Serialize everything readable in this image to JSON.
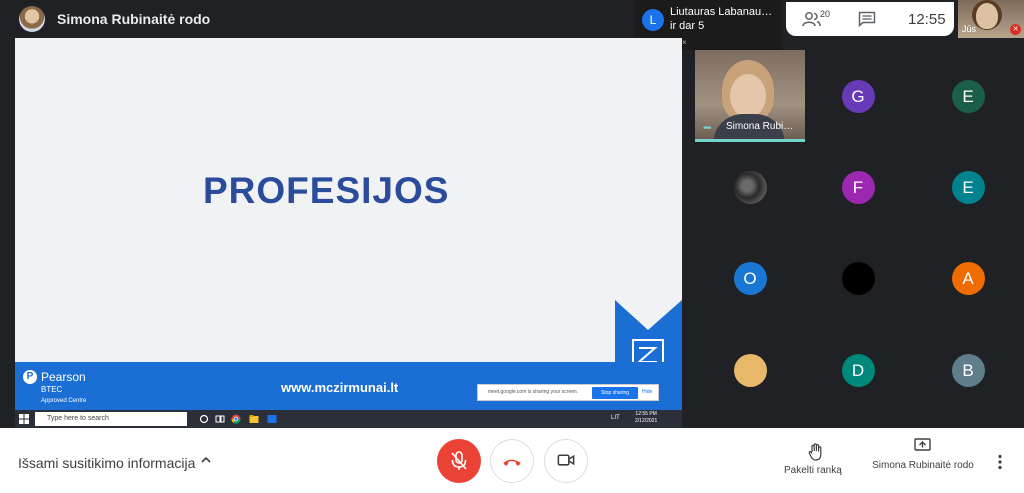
{
  "topbar": {
    "presenter_title": "Simona Rubinaitė rodo"
  },
  "notification": {
    "avatar_letter": "L",
    "name": "Liutauras Labanau…",
    "more": "ir dar 5",
    "controls": [
      "–",
      "▫",
      "×"
    ]
  },
  "header_pill": {
    "people_icon": "people-icon",
    "people_count": "20",
    "chat_icon": "chat-icon",
    "time": "12:55"
  },
  "self_view": {
    "label": "Jūs",
    "mic_icon": "mic-off-icon"
  },
  "shared_screen": {
    "slide_title": "PROFESIJOS",
    "pearson_logo": "P",
    "pearson": "Pearson",
    "btec": "BTEC",
    "approved": "Approved Centre",
    "website": "www.mczirmunai.lt",
    "share_notice": {
      "text": "meet.google.com is sharing your screen.",
      "stop_label": "Stop sharing",
      "hide_label": "Hide"
    },
    "taskbar": {
      "search_placeholder": "Type here to search",
      "lang": "LIT",
      "time": "12:55 PM",
      "date": "2/12/2021"
    },
    "colors": {
      "banner": "#1b6fd4",
      "title": "#2b4b9b"
    }
  },
  "participants": {
    "active": {
      "name": "Simona Rubi…",
      "indicator": "•••"
    },
    "tiles": [
      {
        "letter": "G",
        "color": "#673ab7"
      },
      {
        "letter": "E",
        "color": "#1b5e4a"
      },
      {
        "letter": "",
        "color": "#2a2a2a",
        "photo": true
      },
      {
        "letter": "F",
        "color": "#9c27b0"
      },
      {
        "letter": "E",
        "color": "#00838f"
      },
      {
        "letter": "O",
        "color": "#1976d2"
      },
      {
        "letter": "",
        "color": "#000000"
      },
      {
        "letter": "A",
        "color": "#ef6c00"
      },
      {
        "letter": "",
        "color": "#e8b86a"
      },
      {
        "letter": "D",
        "color": "#00897b"
      },
      {
        "letter": "B",
        "color": "#607d8b"
      }
    ]
  },
  "bottombar": {
    "meeting_info": "Išsami susitikimo informacija",
    "chevron_icon": "chevron-up-icon",
    "mic_icon": "mic-off-icon",
    "hangup_icon": "call-end-icon",
    "camera_icon": "videocam-icon",
    "hand_label": "Pakelti ranką",
    "present_label": "Simona Rubinaitė rodo",
    "more_icon": "more-vert-icon",
    "colors": {
      "mic": "#ea4335",
      "hangup": "#ea4335"
    }
  }
}
